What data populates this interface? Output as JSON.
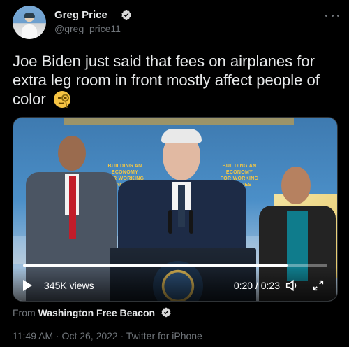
{
  "header": {
    "name": "Greg Price",
    "handle": "@greg_price11"
  },
  "tweet": {
    "text": "Joe Biden just said that fees on airplanes for extra leg room in front mostly affect people of color",
    "emoji": "face-with-monocle"
  },
  "video": {
    "views": "345K views",
    "time": "0:20 / 0:23",
    "progress": 0.87,
    "backdrop_text_left": "BUILDING AN ECONOMY\nFOR WORKING FAMILIES",
    "backdrop_text_right": "BUILDING AN ECONOMY\nFOR WORKING FAMILIES"
  },
  "source": {
    "prefix": "From",
    "name": "Washington Free Beacon"
  },
  "meta": {
    "line": "11:49 AM · Oct 26, 2022 · Twitter for iPhone"
  },
  "colors": {
    "background": "#000000",
    "verified": "#d9d9d9",
    "muted": "#71767b"
  }
}
